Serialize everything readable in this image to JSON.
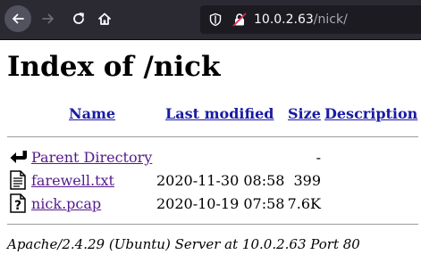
{
  "browser": {
    "url_host": "10.0.2.63",
    "url_path": "/nick/"
  },
  "page": {
    "title": "Index of /nick",
    "columns": {
      "name": "Name",
      "last_modified": "Last modified",
      "size": "Size",
      "description": "Description"
    },
    "rows": [
      {
        "icon": "back-arrow-icon",
        "name": "Parent Directory",
        "date": "",
        "size": "-"
      },
      {
        "icon": "text-file-icon",
        "name": "farewell.txt",
        "date": "2020-11-30 08:58",
        "size": "399"
      },
      {
        "icon": "unknown-file-icon",
        "name": "nick.pcap",
        "date": "2020-10-19 07:58",
        "size": "7.6K"
      }
    ],
    "footer": "Apache/2.4.29 (Ubuntu) Server at 10.0.2.63 Port 80"
  },
  "colors": {
    "toolbar_bg": "#2b2a33",
    "urlbar_bg": "#1c1b22",
    "link_unvisited": "#1a1aa6",
    "link_visited": "#551a8b"
  }
}
